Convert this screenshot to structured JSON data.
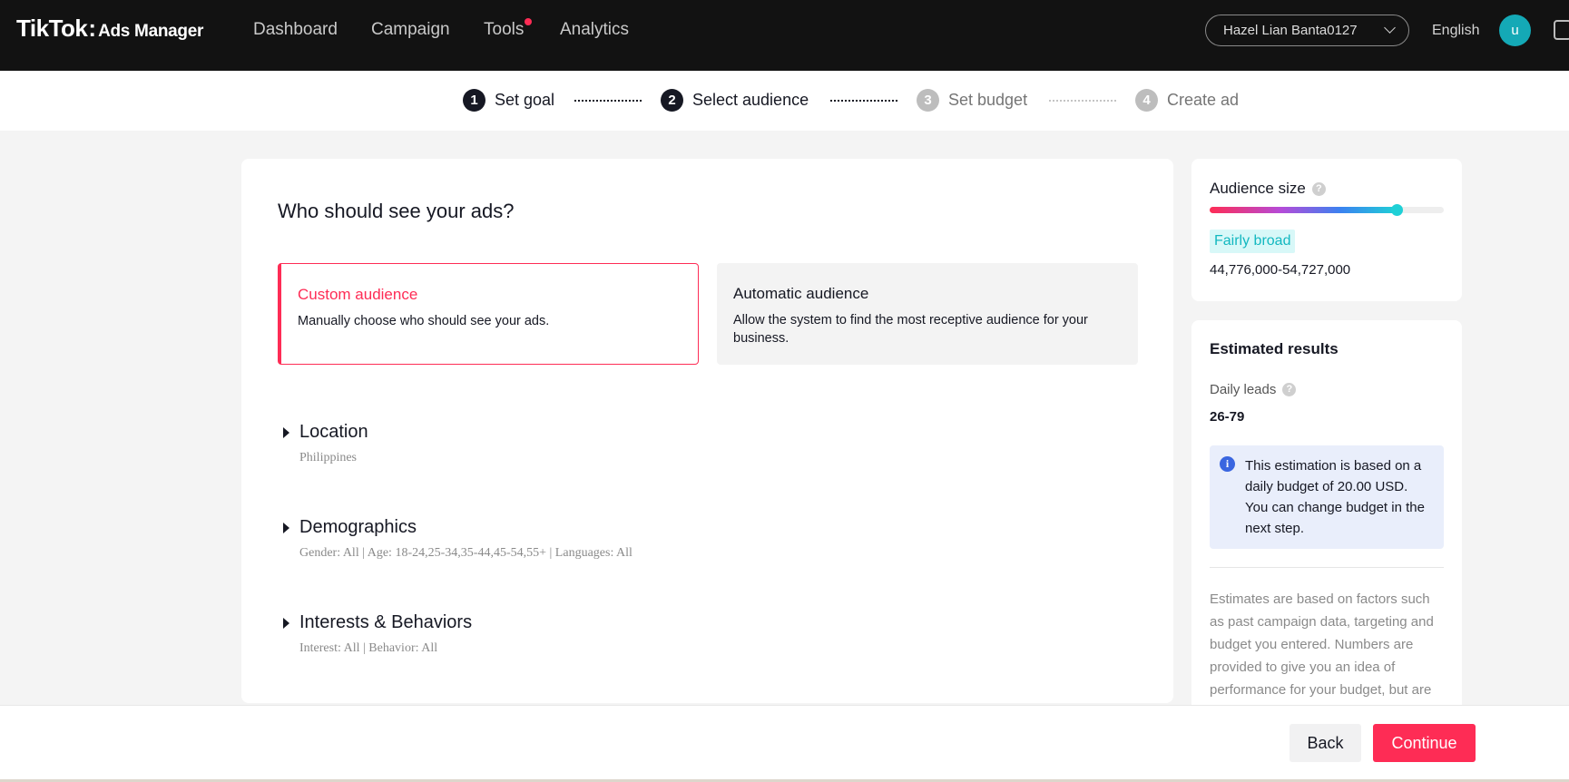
{
  "header": {
    "logo_main": "TikTok",
    "logo_sub": "Ads Manager",
    "nav": [
      {
        "label": "Dashboard"
      },
      {
        "label": "Campaign"
      },
      {
        "label": "Tools"
      },
      {
        "label": "Analytics"
      }
    ],
    "account_name": "Hazel Lian Banta0127",
    "language": "English",
    "avatar_initial": "u"
  },
  "stepper": {
    "steps": [
      {
        "num": "1",
        "label": "Set goal",
        "state": "active"
      },
      {
        "num": "2",
        "label": "Select audience",
        "state": "active"
      },
      {
        "num": "3",
        "label": "Set budget",
        "state": "inactive"
      },
      {
        "num": "4",
        "label": "Create ad",
        "state": "inactive"
      }
    ]
  },
  "main": {
    "title": "Who should see your ads?",
    "options": {
      "custom": {
        "title": "Custom audience",
        "desc": "Manually choose who should see your ads.",
        "selected": true
      },
      "automatic": {
        "title": "Automatic audience",
        "desc": "Allow the system to find the most receptive audience for your business.",
        "selected": false
      }
    },
    "sections": [
      {
        "title": "Location",
        "summary": "Philippines"
      },
      {
        "title": "Demographics",
        "summary": "Gender: All | Age: 18-24,25-34,35-44,45-54,55+ | Languages: All"
      },
      {
        "title": "Interests & Behaviors",
        "summary": "Interest: All | Behavior: All"
      }
    ]
  },
  "audience": {
    "label": "Audience size",
    "level_fraction": 0.8,
    "breadth": "Fairly broad",
    "range": "44,776,000-54,727,000"
  },
  "estimated": {
    "title": "Estimated results",
    "daily_label": "Daily leads",
    "daily_value": "26-79",
    "info": "This estimation is based on a daily budget of 20.00 USD. You can change budget in the next step.",
    "note": "Estimates are based on factors such as past campaign data, targeting and budget you entered. Numbers are provided to give you an idea of performance for your budget, but are"
  },
  "footer": {
    "back_label": "Back",
    "continue_label": "Continue"
  },
  "colors": {
    "accent": "#fe2c55",
    "teal": "#1fd0d6",
    "topbar": "#121212"
  }
}
